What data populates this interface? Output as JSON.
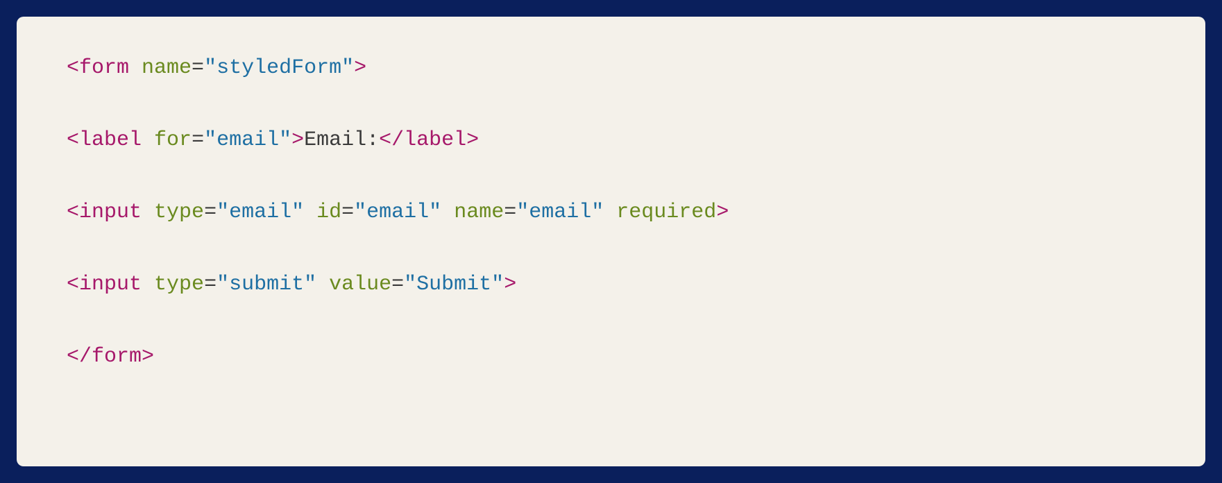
{
  "code": {
    "lines": [
      {
        "tokens": [
          {
            "cls": "tag",
            "t": "<form"
          },
          {
            "cls": null,
            "t": " "
          },
          {
            "cls": "attr",
            "t": "name"
          },
          {
            "cls": "punct",
            "t": "="
          },
          {
            "cls": "str",
            "t": "\"styledForm\""
          },
          {
            "cls": "tag",
            "t": ">"
          }
        ]
      },
      {
        "tokens": [
          {
            "cls": "tag",
            "t": "<label"
          },
          {
            "cls": null,
            "t": " "
          },
          {
            "cls": "attr",
            "t": "for"
          },
          {
            "cls": "punct",
            "t": "="
          },
          {
            "cls": "str",
            "t": "\"email\""
          },
          {
            "cls": "tag",
            "t": ">"
          },
          {
            "cls": "text",
            "t": "Email:"
          },
          {
            "cls": "tag",
            "t": "</label>"
          }
        ]
      },
      {
        "tokens": [
          {
            "cls": "tag",
            "t": "<input"
          },
          {
            "cls": null,
            "t": " "
          },
          {
            "cls": "attr",
            "t": "type"
          },
          {
            "cls": "punct",
            "t": "="
          },
          {
            "cls": "str",
            "t": "\"email\""
          },
          {
            "cls": null,
            "t": " "
          },
          {
            "cls": "attr",
            "t": "id"
          },
          {
            "cls": "punct",
            "t": "="
          },
          {
            "cls": "str",
            "t": "\"email\""
          },
          {
            "cls": null,
            "t": " "
          },
          {
            "cls": "attr",
            "t": "name"
          },
          {
            "cls": "punct",
            "t": "="
          },
          {
            "cls": "str",
            "t": "\"email\""
          },
          {
            "cls": null,
            "t": " "
          },
          {
            "cls": "attr",
            "t": "required"
          },
          {
            "cls": "tag",
            "t": ">"
          }
        ]
      },
      {
        "tokens": [
          {
            "cls": "tag",
            "t": "<input"
          },
          {
            "cls": null,
            "t": " "
          },
          {
            "cls": "attr",
            "t": "type"
          },
          {
            "cls": "punct",
            "t": "="
          },
          {
            "cls": "str",
            "t": "\"submit\""
          },
          {
            "cls": null,
            "t": " "
          },
          {
            "cls": "attr",
            "t": "value"
          },
          {
            "cls": "punct",
            "t": "="
          },
          {
            "cls": "str",
            "t": "\"Submit\""
          },
          {
            "cls": "tag",
            "t": ">"
          }
        ]
      },
      {
        "tokens": [
          {
            "cls": "tag",
            "t": "</form>"
          }
        ]
      }
    ]
  }
}
